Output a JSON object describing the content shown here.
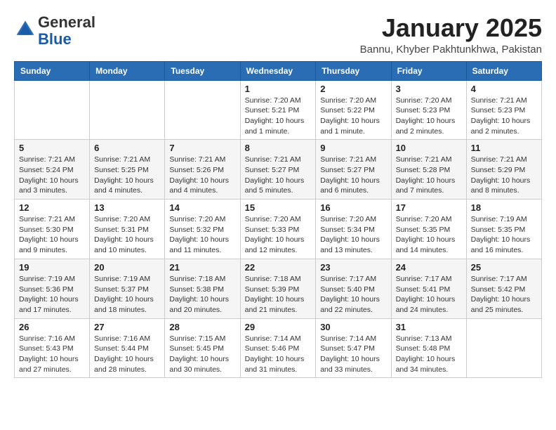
{
  "logo": {
    "general": "General",
    "blue": "Blue"
  },
  "header": {
    "title": "January 2025",
    "location": "Bannu, Khyber Pakhtunkhwa, Pakistan"
  },
  "weekdays": [
    "Sunday",
    "Monday",
    "Tuesday",
    "Wednesday",
    "Thursday",
    "Friday",
    "Saturday"
  ],
  "weeks": [
    [
      {
        "day": "",
        "info": ""
      },
      {
        "day": "",
        "info": ""
      },
      {
        "day": "",
        "info": ""
      },
      {
        "day": "1",
        "info": "Sunrise: 7:20 AM\nSunset: 5:21 PM\nDaylight: 10 hours\nand 1 minute."
      },
      {
        "day": "2",
        "info": "Sunrise: 7:20 AM\nSunset: 5:22 PM\nDaylight: 10 hours\nand 1 minute."
      },
      {
        "day": "3",
        "info": "Sunrise: 7:20 AM\nSunset: 5:23 PM\nDaylight: 10 hours\nand 2 minutes."
      },
      {
        "day": "4",
        "info": "Sunrise: 7:21 AM\nSunset: 5:23 PM\nDaylight: 10 hours\nand 2 minutes."
      }
    ],
    [
      {
        "day": "5",
        "info": "Sunrise: 7:21 AM\nSunset: 5:24 PM\nDaylight: 10 hours\nand 3 minutes."
      },
      {
        "day": "6",
        "info": "Sunrise: 7:21 AM\nSunset: 5:25 PM\nDaylight: 10 hours\nand 4 minutes."
      },
      {
        "day": "7",
        "info": "Sunrise: 7:21 AM\nSunset: 5:26 PM\nDaylight: 10 hours\nand 4 minutes."
      },
      {
        "day": "8",
        "info": "Sunrise: 7:21 AM\nSunset: 5:27 PM\nDaylight: 10 hours\nand 5 minutes."
      },
      {
        "day": "9",
        "info": "Sunrise: 7:21 AM\nSunset: 5:27 PM\nDaylight: 10 hours\nand 6 minutes."
      },
      {
        "day": "10",
        "info": "Sunrise: 7:21 AM\nSunset: 5:28 PM\nDaylight: 10 hours\nand 7 minutes."
      },
      {
        "day": "11",
        "info": "Sunrise: 7:21 AM\nSunset: 5:29 PM\nDaylight: 10 hours\nand 8 minutes."
      }
    ],
    [
      {
        "day": "12",
        "info": "Sunrise: 7:21 AM\nSunset: 5:30 PM\nDaylight: 10 hours\nand 9 minutes."
      },
      {
        "day": "13",
        "info": "Sunrise: 7:20 AM\nSunset: 5:31 PM\nDaylight: 10 hours\nand 10 minutes."
      },
      {
        "day": "14",
        "info": "Sunrise: 7:20 AM\nSunset: 5:32 PM\nDaylight: 10 hours\nand 11 minutes."
      },
      {
        "day": "15",
        "info": "Sunrise: 7:20 AM\nSunset: 5:33 PM\nDaylight: 10 hours\nand 12 minutes."
      },
      {
        "day": "16",
        "info": "Sunrise: 7:20 AM\nSunset: 5:34 PM\nDaylight: 10 hours\nand 13 minutes."
      },
      {
        "day": "17",
        "info": "Sunrise: 7:20 AM\nSunset: 5:35 PM\nDaylight: 10 hours\nand 14 minutes."
      },
      {
        "day": "18",
        "info": "Sunrise: 7:19 AM\nSunset: 5:35 PM\nDaylight: 10 hours\nand 16 minutes."
      }
    ],
    [
      {
        "day": "19",
        "info": "Sunrise: 7:19 AM\nSunset: 5:36 PM\nDaylight: 10 hours\nand 17 minutes."
      },
      {
        "day": "20",
        "info": "Sunrise: 7:19 AM\nSunset: 5:37 PM\nDaylight: 10 hours\nand 18 minutes."
      },
      {
        "day": "21",
        "info": "Sunrise: 7:18 AM\nSunset: 5:38 PM\nDaylight: 10 hours\nand 20 minutes."
      },
      {
        "day": "22",
        "info": "Sunrise: 7:18 AM\nSunset: 5:39 PM\nDaylight: 10 hours\nand 21 minutes."
      },
      {
        "day": "23",
        "info": "Sunrise: 7:17 AM\nSunset: 5:40 PM\nDaylight: 10 hours\nand 22 minutes."
      },
      {
        "day": "24",
        "info": "Sunrise: 7:17 AM\nSunset: 5:41 PM\nDaylight: 10 hours\nand 24 minutes."
      },
      {
        "day": "25",
        "info": "Sunrise: 7:17 AM\nSunset: 5:42 PM\nDaylight: 10 hours\nand 25 minutes."
      }
    ],
    [
      {
        "day": "26",
        "info": "Sunrise: 7:16 AM\nSunset: 5:43 PM\nDaylight: 10 hours\nand 27 minutes."
      },
      {
        "day": "27",
        "info": "Sunrise: 7:16 AM\nSunset: 5:44 PM\nDaylight: 10 hours\nand 28 minutes."
      },
      {
        "day": "28",
        "info": "Sunrise: 7:15 AM\nSunset: 5:45 PM\nDaylight: 10 hours\nand 30 minutes."
      },
      {
        "day": "29",
        "info": "Sunrise: 7:14 AM\nSunset: 5:46 PM\nDaylight: 10 hours\nand 31 minutes."
      },
      {
        "day": "30",
        "info": "Sunrise: 7:14 AM\nSunset: 5:47 PM\nDaylight: 10 hours\nand 33 minutes."
      },
      {
        "day": "31",
        "info": "Sunrise: 7:13 AM\nSunset: 5:48 PM\nDaylight: 10 hours\nand 34 minutes."
      },
      {
        "day": "",
        "info": ""
      }
    ]
  ]
}
